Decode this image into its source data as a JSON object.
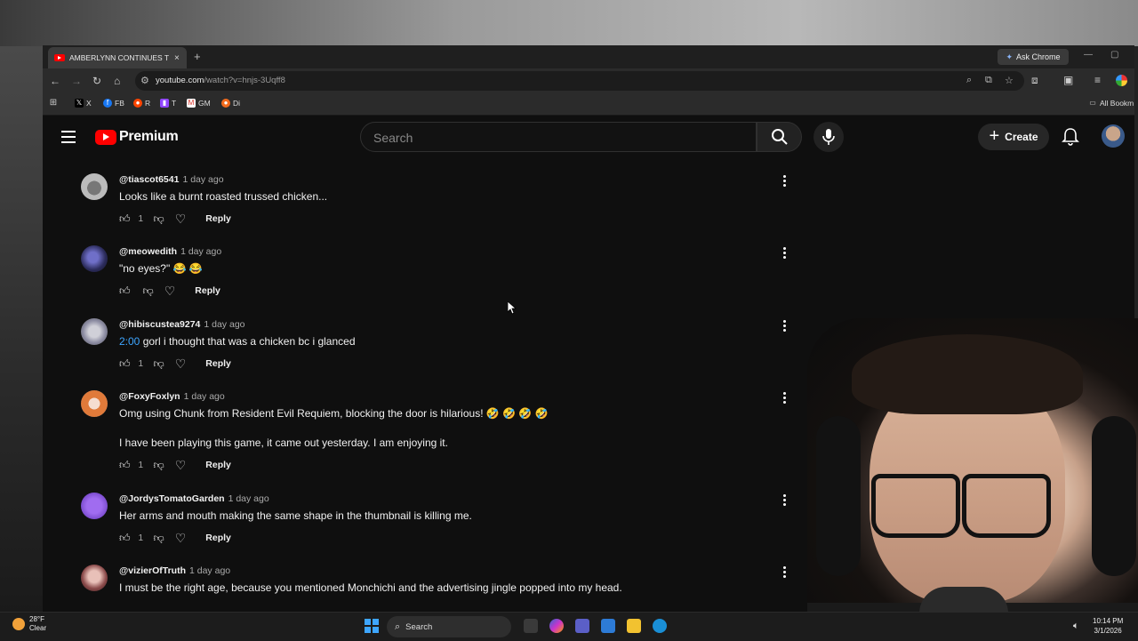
{
  "browser": {
    "tab_title": "AMBERLYNN CONTINUES TO M",
    "tab_close": "×",
    "new_tab": "+",
    "ask_chrome": "Ask Chrome",
    "url_host": "youtube.com",
    "url_path": "/watch?v=hnjs-3Uqff8",
    "bookmarks": [
      {
        "label": "X",
        "icon": "x-logo"
      },
      {
        "label": "FB",
        "icon": "facebook-logo"
      },
      {
        "label": "R",
        "icon": "reddit-logo"
      },
      {
        "label": "T",
        "icon": "twitch-logo"
      },
      {
        "label": "GM",
        "icon": "gmail-logo"
      },
      {
        "label": "Di",
        "icon": "disney-logo"
      }
    ],
    "all_bookmarks": "All Bookm"
  },
  "youtube": {
    "logo_text": "Premium",
    "search_placeholder": "Search",
    "create_label": "Create"
  },
  "comments": [
    {
      "author": "@tiascot6541",
      "time": "1 day ago",
      "text": "Looks like a burnt roasted trussed chicken...",
      "likes": "1",
      "reply": "Reply"
    },
    {
      "author": "@meowedith",
      "time": "1 day ago",
      "text": "\"no eyes?\" 😂 😂",
      "likes": "",
      "reply": "Reply"
    },
    {
      "author": "@hibiscustea9274",
      "time": "1 day ago",
      "timestamp": "2:00",
      "text": " gorl i thought that was a chicken bc i glanced",
      "likes": "1",
      "reply": "Reply"
    },
    {
      "author": "@FoxyFoxlyn",
      "time": "1 day ago",
      "text": "Omg using Chunk from Resident Evil Requiem, blocking the door is hilarious! 🤣 🤣 🤣 🤣",
      "text2": "I have been playing this game, it came out yesterday.  I am enjoying it.",
      "likes": "1",
      "reply": "Reply"
    },
    {
      "author": "@JordysTomatoGarden",
      "time": "1 day ago",
      "text": "Her arms and mouth making the same shape in the thumbnail is killing me.",
      "likes": "1",
      "reply": "Reply"
    },
    {
      "author": "@vizierOfTruth",
      "time": "1 day ago",
      "text": "I must be the right age, because you mentioned Monchichi and the advertising jingle popped into my head."
    }
  ],
  "taskbar": {
    "temp": "28°F",
    "condition": "Clear",
    "search_label": "Search",
    "time": "10:14 PM",
    "date": "3/1/2026"
  },
  "colors": {
    "yt_red": "#ff0000",
    "link_blue": "#3ea6ff",
    "page_bg": "#0f0f0f"
  }
}
